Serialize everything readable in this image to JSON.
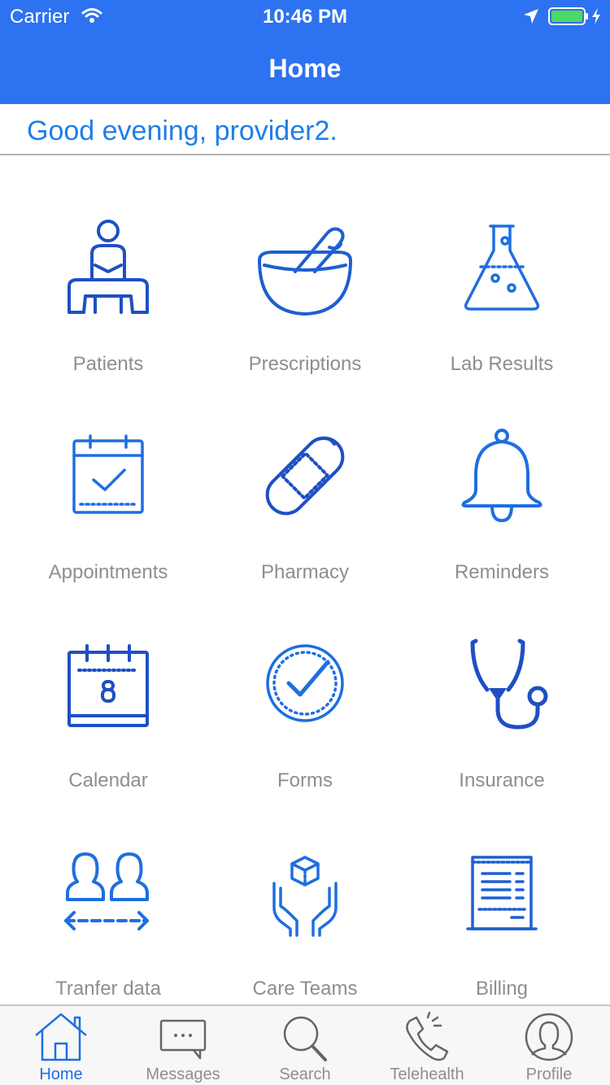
{
  "status_bar": {
    "carrier": "Carrier",
    "time": "10:46 PM"
  },
  "nav": {
    "title": "Home"
  },
  "greeting": "Good evening, provider2.",
  "grid": [
    {
      "label": "Patients",
      "icon": "patient-icon"
    },
    {
      "label": "Prescriptions",
      "icon": "mortar-pestle-icon"
    },
    {
      "label": "Lab Results",
      "icon": "flask-icon"
    },
    {
      "label": "Appointments",
      "icon": "calendar-check-icon"
    },
    {
      "label": "Pharmacy",
      "icon": "bandage-icon"
    },
    {
      "label": "Reminders",
      "icon": "bell-icon"
    },
    {
      "label": "Calendar",
      "icon": "calendar-icon"
    },
    {
      "label": "Forms",
      "icon": "check-circle-icon"
    },
    {
      "label": "Insurance",
      "icon": "stethoscope-icon"
    },
    {
      "label": "Tranfer data",
      "icon": "transfer-users-icon"
    },
    {
      "label": "Care Teams",
      "icon": "hands-box-icon"
    },
    {
      "label": "Billing",
      "icon": "receipt-icon"
    }
  ],
  "tabs": [
    {
      "label": "Home",
      "icon": "home-icon",
      "active": true
    },
    {
      "label": "Messages",
      "icon": "chat-icon",
      "active": false
    },
    {
      "label": "Search",
      "icon": "search-icon",
      "active": false
    },
    {
      "label": "Telehealth",
      "icon": "phone-icon",
      "active": false
    },
    {
      "label": "Profile",
      "icon": "profile-icon",
      "active": false
    }
  ],
  "colors": {
    "primary": "#2d72f0",
    "icon": "#1e5fd2",
    "label": "#8e8e8e",
    "greeting": "#1f7ee6"
  }
}
